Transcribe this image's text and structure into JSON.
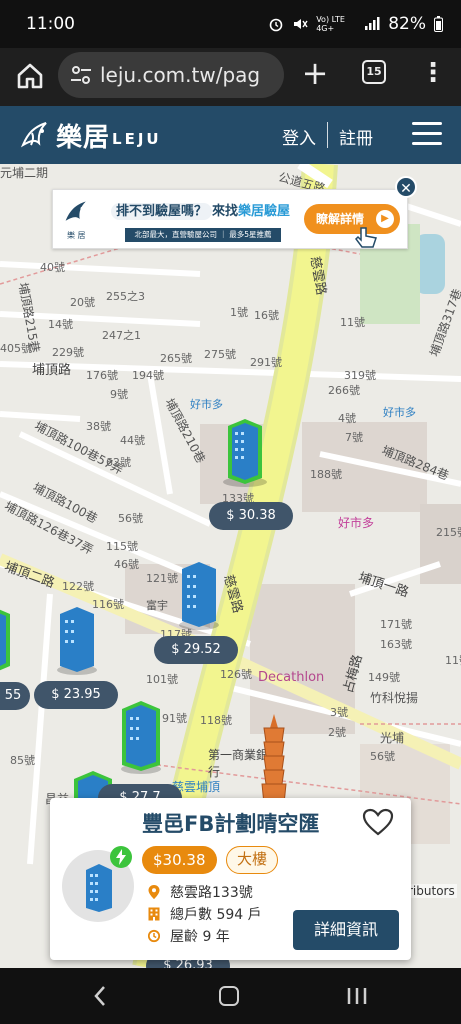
{
  "status_bar": {
    "time": "11:00",
    "network": "Vo) LTE 4G+",
    "battery": "82%"
  },
  "browser": {
    "url": "leju.com.tw/pag",
    "tab_count": "15"
  },
  "header": {
    "logo_cn": "樂居",
    "logo_en": "LEJU",
    "login": "登入",
    "register": "註冊"
  },
  "ad": {
    "title_question": "排不到驗屋嗎？",
    "title_prefix": "來找",
    "title_highlight": "樂居驗屋",
    "logo_text": "樂 居",
    "subtitle": "北部最大，直營驗屋公司 ｜ 最多5星推薦",
    "button": "瞭解詳情"
  },
  "map": {
    "road_labels": [
      "埔頂路",
      "埔頂二路",
      "埔頂一路",
      "埔頂路284巷",
      "埔頂路100巷57弄",
      "埔頂路100巷",
      "埔頂路126巷37弄",
      "埔頂路210巷",
      "埔頂路215巷",
      "埔頂路317巷",
      "慈雲路",
      "慈雲路",
      "公道五路",
      "占梅路",
      "昌益",
      "光埔",
      "竹科悅揚",
      "元埔二期"
    ],
    "pois": [
      "好市多",
      "好市多",
      "Decathlon",
      "第一商業銀行",
      "富宇",
      "慈雲埔頂",
      "豐"
    ],
    "address_numbers": [
      "40號",
      "20號",
      "255之3",
      "14號",
      "247之1",
      "229號",
      "265號",
      "275號",
      "291號",
      "319號",
      "176號",
      "194號",
      "9號",
      "1號",
      "16號",
      "11號",
      "266號",
      "4號",
      "7號",
      "38號",
      "44號",
      "62號",
      "188號",
      "56號",
      "115號",
      "46號",
      "121號",
      "122號",
      "116號",
      "117號",
      "101號",
      "91號",
      "118號",
      "126號",
      "171號",
      "163號",
      "149號",
      "85號",
      "3號",
      "2號",
      "56號",
      "133號",
      "215號",
      "11號",
      "405號",
      "133號"
    ],
    "attribution": "ributors"
  },
  "markers": [
    {
      "price": "$ 30.38"
    },
    {
      "price": "$ 29.52"
    },
    {
      "price": "$ 23.95"
    },
    {
      "price": "55"
    },
    {
      "price": "$ 27.7"
    },
    {
      "price": "$ 26.93"
    }
  ],
  "card": {
    "title": "豐邑FB計劃晴空匯",
    "price": "$30.38",
    "type": "大樓",
    "address": "慈雲路133號",
    "households": "總戶數 594 戶",
    "age": "屋齡 9 年",
    "detail_button": "詳細資訊"
  },
  "colors": {
    "brand_navy": "#244b68",
    "price_orange": "#e88a0e",
    "highlight_green": "#3cc43c",
    "price_tag": "#40556a"
  }
}
